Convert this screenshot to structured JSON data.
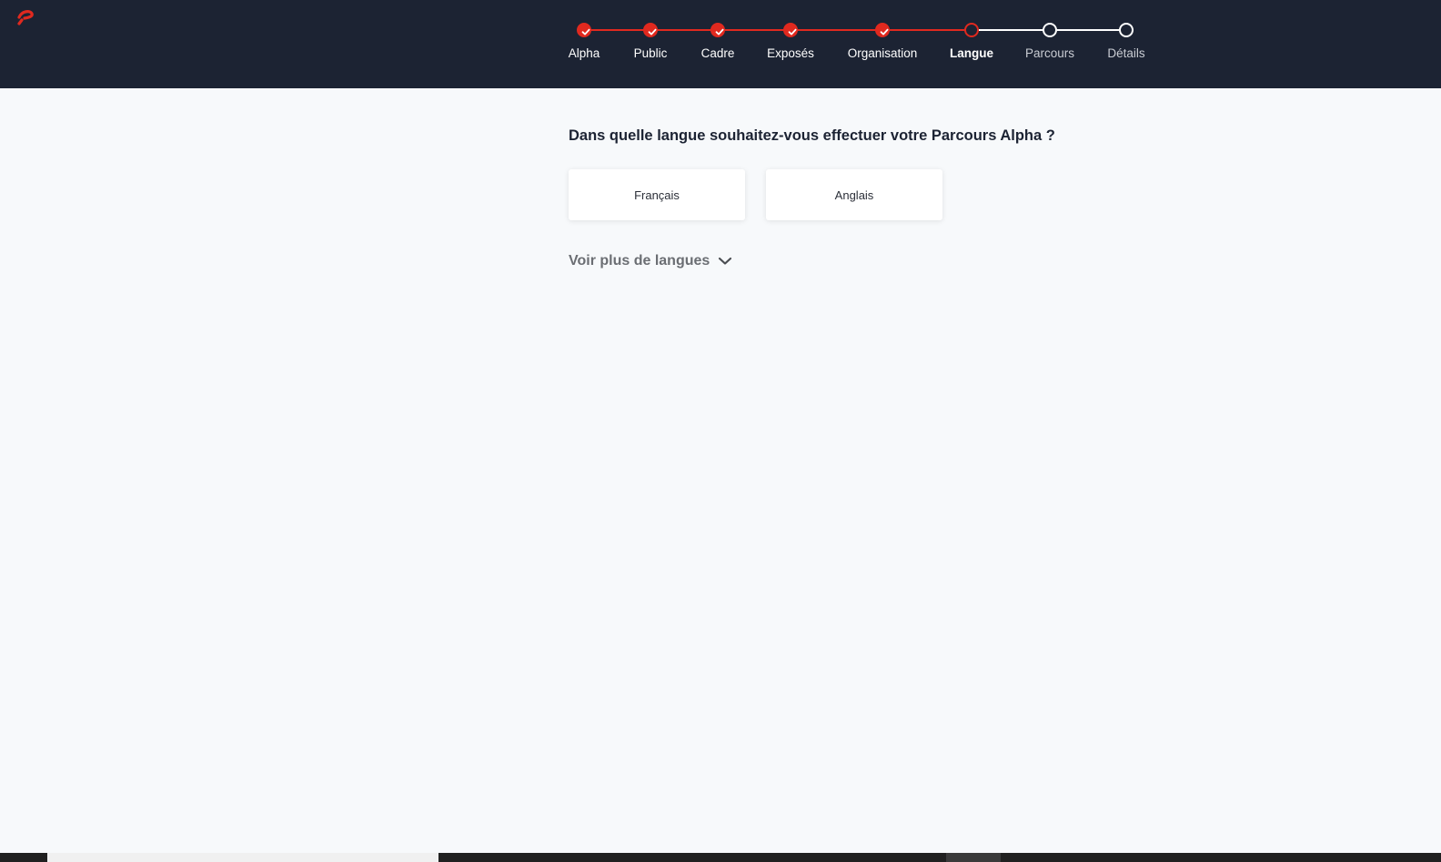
{
  "header": {
    "logo_icon": "brand-logo-icon",
    "background_color": "#1c2333",
    "accent_color": "#e0291f"
  },
  "stepper": {
    "steps": [
      {
        "label": "Alpha",
        "state": "done"
      },
      {
        "label": "Public",
        "state": "done"
      },
      {
        "label": "Cadre",
        "state": "done"
      },
      {
        "label": "Exposés",
        "state": "done"
      },
      {
        "label": "Organisation",
        "state": "done"
      },
      {
        "label": "Langue",
        "state": "current"
      },
      {
        "label": "Parcours",
        "state": "todo"
      },
      {
        "label": "Détails",
        "state": "todo"
      }
    ]
  },
  "main": {
    "question": "Dans quelle langue souhaitez-vous effectuer votre Parcours Alpha ?",
    "options": [
      {
        "label": "Français"
      },
      {
        "label": "Anglais"
      }
    ],
    "more_languages_label": "Voir plus de langues",
    "more_languages_icon": "chevron-down-icon"
  }
}
